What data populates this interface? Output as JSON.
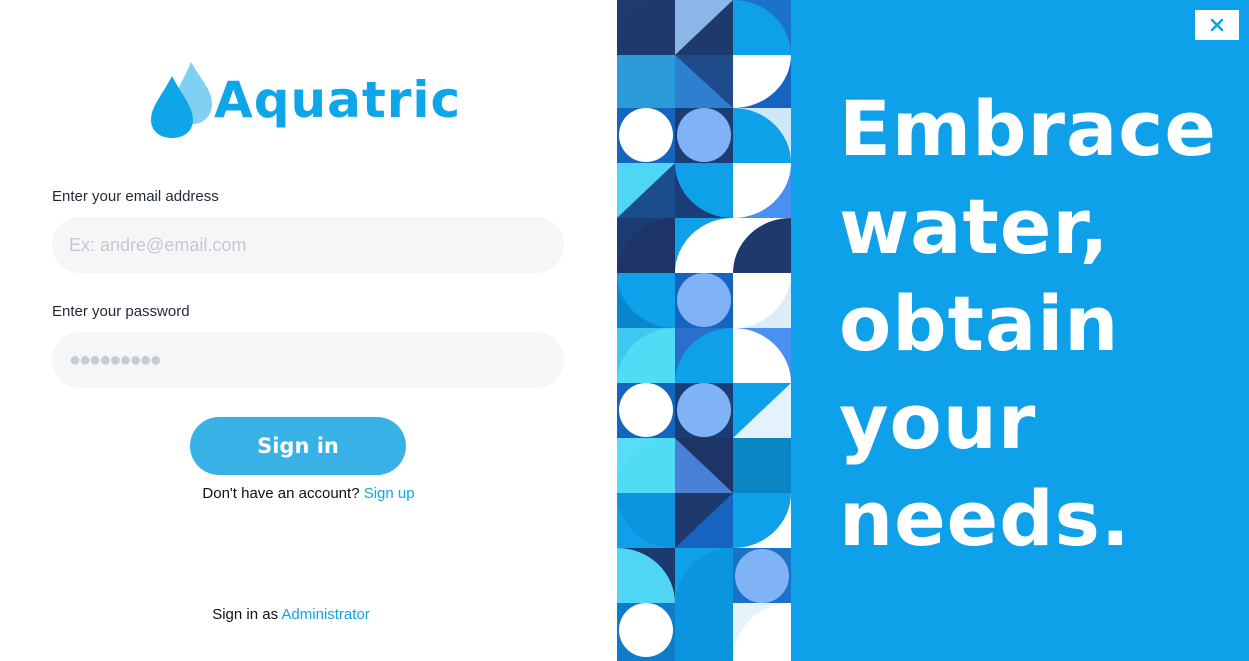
{
  "brand": {
    "name": "Aquatric",
    "primary_color": "#0ea5e9"
  },
  "form": {
    "email_label": "Enter your email address",
    "email_placeholder": "Ex: andre@email.com",
    "email_value": "",
    "password_label": "Enter your password",
    "password_placeholder": "●●●●●●●●●",
    "password_value": "",
    "signin_label": "Sign in",
    "signup_prompt": "Don't have an account?",
    "signup_link": "Sign up",
    "admin_prompt": "Sign in as",
    "admin_link": "Administrator"
  },
  "hero": {
    "tagline_lines": [
      "Embrace",
      "water,",
      "obtain",
      "your",
      "needs."
    ],
    "background_color": "#0ea0e8"
  },
  "window": {
    "close_icon": "close-icon"
  }
}
